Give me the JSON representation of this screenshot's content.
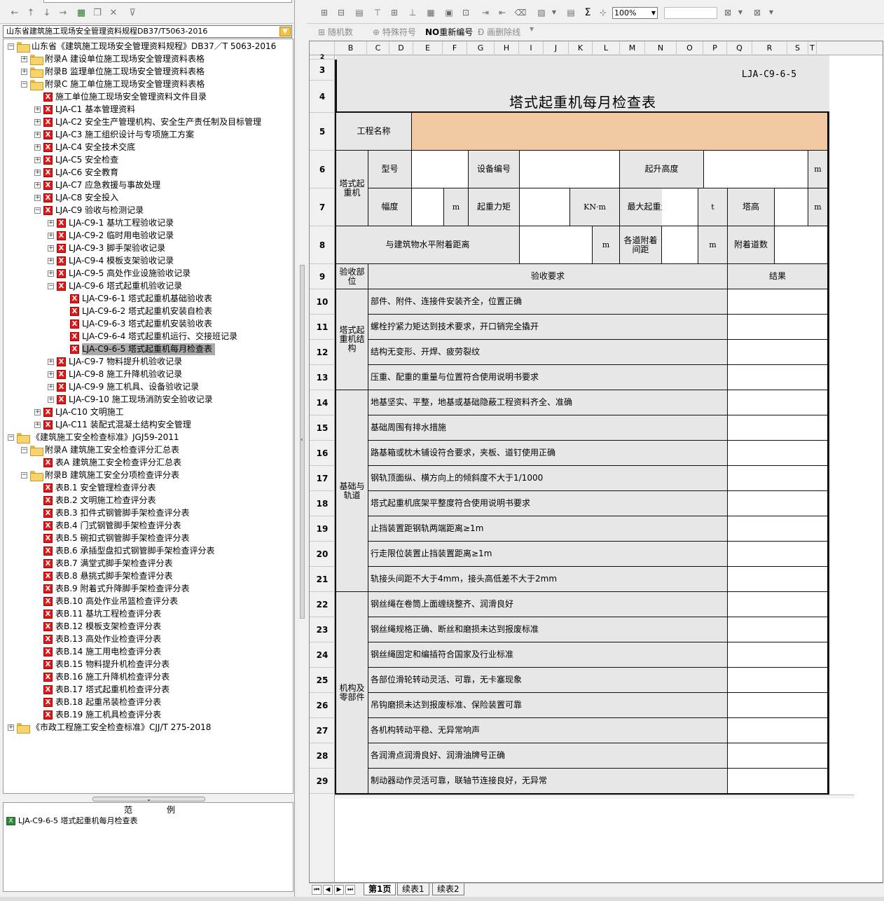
{
  "left": {
    "combo_value": "山东省建筑施工现场安全管理资料规程DB37/T5063-2016",
    "tree": [
      {
        "depth": 0,
        "exp": "-",
        "icon": "folder-open",
        "label": "山东省《建筑施工现场安全管理资料规程》DB37／T 5063-2016"
      },
      {
        "depth": 1,
        "exp": "+",
        "icon": "folder",
        "label": "附录A 建设单位施工现场安全管理资料表格"
      },
      {
        "depth": 1,
        "exp": "+",
        "icon": "folder",
        "label": "附录B 监理单位施工现场安全管理资料表格"
      },
      {
        "depth": 1,
        "exp": "-",
        "icon": "folder-open",
        "label": "附录C 施工单位施工现场安全管理资料表格"
      },
      {
        "depth": 2,
        "exp": "",
        "icon": "excel",
        "label": "施工单位施工现场安全管理资料文件目录"
      },
      {
        "depth": 2,
        "exp": "+",
        "icon": "excel",
        "label": "LJA-C1 基本管理资料"
      },
      {
        "depth": 2,
        "exp": "+",
        "icon": "excel",
        "label": "LJA-C2 安全生产管理机构、安全生产责任制及目标管理"
      },
      {
        "depth": 2,
        "exp": "+",
        "icon": "excel",
        "label": "LJA-C3 施工组织设计与专项施工方案"
      },
      {
        "depth": 2,
        "exp": "+",
        "icon": "excel",
        "label": "LJA-C4 安全技术交底"
      },
      {
        "depth": 2,
        "exp": "+",
        "icon": "excel",
        "label": "LJA-C5 安全检查"
      },
      {
        "depth": 2,
        "exp": "+",
        "icon": "excel",
        "label": "LJA-C6 安全教育"
      },
      {
        "depth": 2,
        "exp": "+",
        "icon": "excel",
        "label": "LJA-C7 应急救援与事故处理"
      },
      {
        "depth": 2,
        "exp": "+",
        "icon": "excel",
        "label": "LJA-C8 安全投入"
      },
      {
        "depth": 2,
        "exp": "-",
        "icon": "excel",
        "label": "LJA-C9 验收与检测记录"
      },
      {
        "depth": 3,
        "exp": "+",
        "icon": "excel",
        "label": "LJA-C9-1 基坑工程验收记录"
      },
      {
        "depth": 3,
        "exp": "+",
        "icon": "excel",
        "label": "LJA-C9-2 临时用电验收记录"
      },
      {
        "depth": 3,
        "exp": "+",
        "icon": "excel",
        "label": "LJA-C9-3 脚手架验收记录"
      },
      {
        "depth": 3,
        "exp": "+",
        "icon": "excel",
        "label": "LJA-C9-4 模板支架验收记录"
      },
      {
        "depth": 3,
        "exp": "+",
        "icon": "excel",
        "label": "LJA-C9-5 高处作业设施验收记录"
      },
      {
        "depth": 3,
        "exp": "-",
        "icon": "excel",
        "label": "LJA-C9-6 塔式起重机验收记录"
      },
      {
        "depth": 4,
        "exp": "",
        "icon": "excel",
        "label": "LJA-C9-6-1 塔式起重机基础验收表"
      },
      {
        "depth": 4,
        "exp": "",
        "icon": "excel",
        "label": "LJA-C9-6-2 塔式起重机安装自检表"
      },
      {
        "depth": 4,
        "exp": "",
        "icon": "excel",
        "label": "LJA-C9-6-3 塔式起重机安装验收表"
      },
      {
        "depth": 4,
        "exp": "",
        "icon": "excel",
        "label": "LJA-C9-6-4 塔式起重机运行、交接班记录"
      },
      {
        "depth": 4,
        "exp": "",
        "icon": "excel",
        "label": "LJA-C9-6-5 塔式起重机每月检查表",
        "selected": true
      },
      {
        "depth": 3,
        "exp": "+",
        "icon": "excel",
        "label": "LJA-C9-7 物料提升机验收记录"
      },
      {
        "depth": 3,
        "exp": "+",
        "icon": "excel",
        "label": "LJA-C9-8 施工升降机验收记录"
      },
      {
        "depth": 3,
        "exp": "+",
        "icon": "excel",
        "label": "LJA-C9-9 施工机具、设备验收记录"
      },
      {
        "depth": 3,
        "exp": "+",
        "icon": "excel",
        "label": "LJA-C9-10 施工现场消防安全验收记录"
      },
      {
        "depth": 2,
        "exp": "+",
        "icon": "excel",
        "label": "LJA-C10 文明施工"
      },
      {
        "depth": 2,
        "exp": "+",
        "icon": "excel",
        "label": "LJA-C11 装配式混凝土结构安全管理"
      },
      {
        "depth": 0,
        "exp": "-",
        "icon": "folder-open",
        "label": "《建筑施工安全检查标准》JGJ59-2011"
      },
      {
        "depth": 1,
        "exp": "-",
        "icon": "folder-open",
        "label": "附录A 建筑施工安全检查评分汇总表"
      },
      {
        "depth": 2,
        "exp": "",
        "icon": "excel",
        "label": "表A 建筑施工安全检查评分汇总表"
      },
      {
        "depth": 1,
        "exp": "-",
        "icon": "folder-open",
        "label": "附录B 建筑施工安全分项检查评分表"
      },
      {
        "depth": 2,
        "exp": "",
        "icon": "excel",
        "label": "表B.1 安全管理检查评分表"
      },
      {
        "depth": 2,
        "exp": "",
        "icon": "excel",
        "label": "表B.2 文明施工检查评分表"
      },
      {
        "depth": 2,
        "exp": "",
        "icon": "excel",
        "label": "表B.3 扣件式钢管脚手架检查评分表"
      },
      {
        "depth": 2,
        "exp": "",
        "icon": "excel",
        "label": "表B.4 门式钢管脚手架检查评分表"
      },
      {
        "depth": 2,
        "exp": "",
        "icon": "excel",
        "label": "表B.5 碗扣式钢管脚手架检查评分表"
      },
      {
        "depth": 2,
        "exp": "",
        "icon": "excel",
        "label": "表B.6 承插型盘扣式钢管脚手架检查评分表"
      },
      {
        "depth": 2,
        "exp": "",
        "icon": "excel",
        "label": "表B.7 满堂式脚手架检查评分表"
      },
      {
        "depth": 2,
        "exp": "",
        "icon": "excel",
        "label": "表B.8 悬挑式脚手架检查评分表"
      },
      {
        "depth": 2,
        "exp": "",
        "icon": "excel",
        "label": "表B.9 附着式升降脚手架检查评分表"
      },
      {
        "depth": 2,
        "exp": "",
        "icon": "excel",
        "label": "表B.10 高处作业吊篮检查评分表"
      },
      {
        "depth": 2,
        "exp": "",
        "icon": "excel",
        "label": "表B.11 基坑工程检查评分表"
      },
      {
        "depth": 2,
        "exp": "",
        "icon": "excel",
        "label": "表B.12 模板支架检查评分表"
      },
      {
        "depth": 2,
        "exp": "",
        "icon": "excel",
        "label": "表B.13 高处作业检查评分表"
      },
      {
        "depth": 2,
        "exp": "",
        "icon": "excel",
        "label": "表B.14 施工用电检查评分表"
      },
      {
        "depth": 2,
        "exp": "",
        "icon": "excel",
        "label": "表B.15 物料提升机检查评分表"
      },
      {
        "depth": 2,
        "exp": "",
        "icon": "excel",
        "label": "表B.16 施工升降机检查评分表"
      },
      {
        "depth": 2,
        "exp": "",
        "icon": "excel",
        "label": "表B.17 塔式起重机检查评分表"
      },
      {
        "depth": 2,
        "exp": "",
        "icon": "excel",
        "label": "表B.18 起重吊装检查评分表"
      },
      {
        "depth": 2,
        "exp": "",
        "icon": "excel",
        "label": "表B.19 施工机具检查评分表"
      },
      {
        "depth": 0,
        "exp": "+",
        "icon": "folder",
        "label": "《市政工程施工安全检查标准》CJJ/T 275-2018"
      }
    ],
    "legend_title_a": "范",
    "legend_title_b": "例",
    "legend_item": "LJA-C9-6-5 塔式起重机每月检查表"
  },
  "toolbar": {
    "zoom": "100%",
    "sigma": "Σ",
    "random_number": "随机数",
    "special_symbol": "特殊符号",
    "renumber_prefix": "NO",
    "renumber": "重新编号",
    "strike_delete": "画删除线"
  },
  "columns": [
    "B",
    "C",
    "D",
    "E",
    "F",
    "G",
    "H",
    "I",
    "J",
    "K",
    "L",
    "M",
    "N",
    "O",
    "P",
    "Q",
    "R",
    "S",
    "T"
  ],
  "rows": [
    "2",
    "3",
    "4",
    "5",
    "6",
    "7",
    "8",
    "9",
    "10",
    "11",
    "12",
    "13",
    "14",
    "15",
    "16",
    "17",
    "18",
    "19",
    "20",
    "21",
    "22",
    "23",
    "24",
    "25",
    "26",
    "27",
    "28",
    "29"
  ],
  "form": {
    "code": "LJA-C9-6-5",
    "title": "塔式起重机每月检查表",
    "project_name": "工程名称",
    "crane_group": "塔式起重机",
    "model": "型号",
    "device_no": "设备编号",
    "lift_height": "起升高度",
    "unit_m": "m",
    "amplitude": "幅度",
    "moment": "起重力矩",
    "unit_knm": "KN·m",
    "max_weight": "最大起重量",
    "unit_t": "t",
    "tower_height": "塔高",
    "attach_distance": "与建筑物水平附着距离",
    "attach_spacing": "各道附着间距",
    "attach_count": "附着道数",
    "accept_part": "验收部位",
    "accept_req": "验收要求",
    "result": "结果",
    "groups": [
      "塔式起重机结构",
      "基础与轨道",
      "机构及零部件"
    ],
    "items": [
      "部件、附件、连接件安装齐全，位置正确",
      "螺栓拧紧力矩达到技术要求，开口销完全撬开",
      "结构无变形、开焊、疲劳裂纹",
      "压重、配重的重量与位置符合使用说明书要求",
      "地基坚实、平整，地基或基础隐蔽工程资料齐全、准确",
      "基础周围有排水措施",
      "路基箱或枕木铺设符合要求，夹板、道钉使用正确",
      "钢轨顶面纵、横方向上的倾斜度不大于1/1000",
      "塔式起重机底架平整度符合使用说明书要求",
      "止挡装置距钢轨两端距离≥1m",
      "行走限位装置止挡装置距离≥1m",
      "轨接头间距不大于4mm，接头高低差不大于2mm",
      "钢丝绳在卷筒上面缠绕整齐、润滑良好",
      "钢丝绳规格正确、断丝和磨损未达到报废标准",
      "钢丝绳固定和编插符合国家及行业标准",
      "各部位滑轮转动灵活、可靠，无卡塞现象",
      "吊钩磨损未达到报废标准、保险装置可靠",
      "各机构转动平稳、无异常响声",
      "各润滑点润滑良好、润滑油牌号正确",
      "制动器动作灵活可靠，联轴节连接良好，无异常"
    ]
  },
  "sheet_tabs": [
    "第1页",
    "续表1",
    "续表2"
  ]
}
